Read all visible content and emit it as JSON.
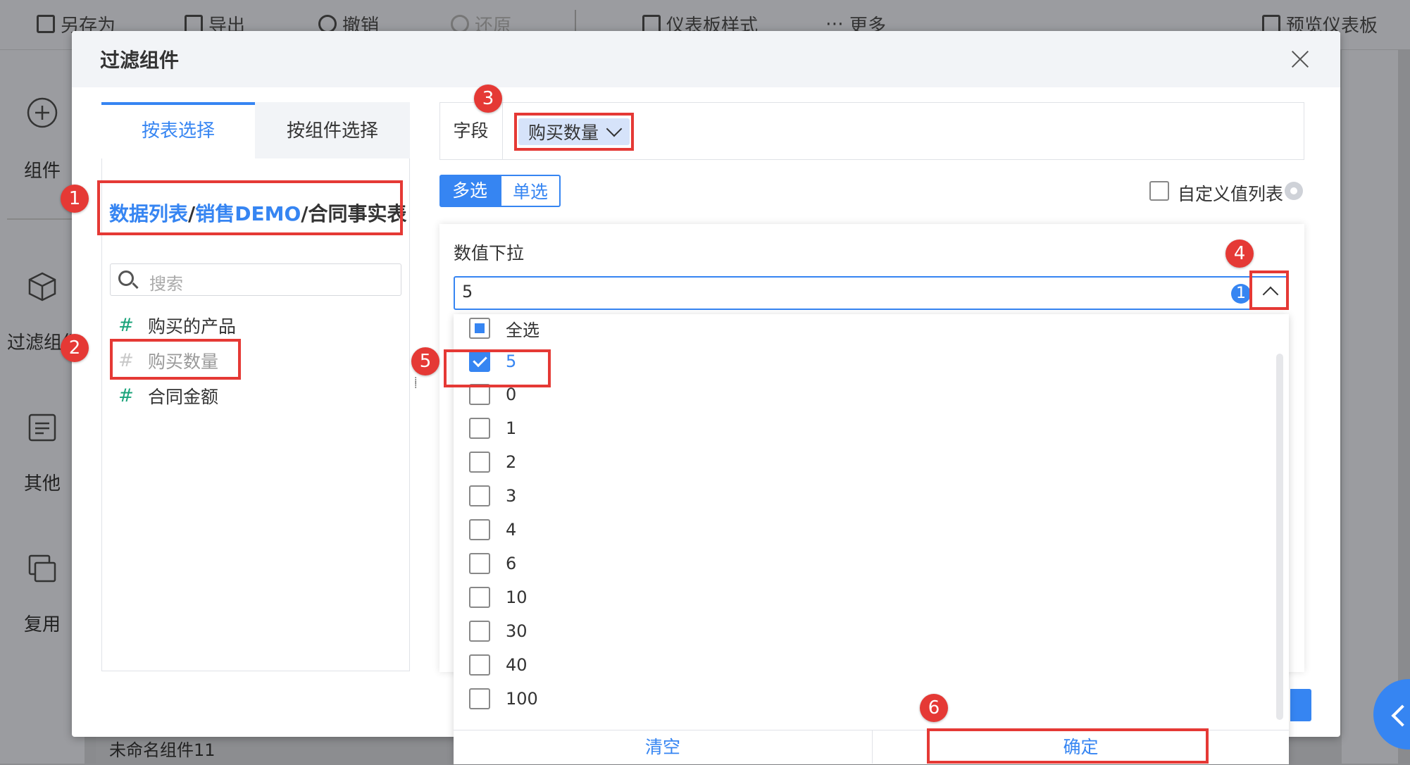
{
  "toolbar": {
    "items": [
      {
        "label": "另存为",
        "icon": "save-as-icon"
      },
      {
        "label": "导出",
        "icon": "export-icon"
      },
      {
        "label": "撤销",
        "icon": "undo-icon"
      },
      {
        "label": "还原",
        "icon": "redo-icon"
      },
      {
        "label": "仪表板样式",
        "icon": "dashboard-style-icon"
      },
      {
        "label": "更多",
        "icon": "more-icon"
      },
      {
        "label": "预览仪表板",
        "icon": "preview-icon"
      }
    ]
  },
  "left_panel": {
    "items": [
      {
        "label": "组件",
        "icon": "plus-circle-icon"
      },
      {
        "label": "过滤组件",
        "icon": "cube-icon"
      },
      {
        "label": "其他",
        "icon": "document-icon"
      },
      {
        "label": "复用",
        "icon": "copy-icon"
      }
    ]
  },
  "bottom_label": "未命名组件11",
  "dialog": {
    "title": "过滤组件",
    "tabs": [
      "按表选择",
      "按组件选择"
    ],
    "breadcrumb": {
      "part1": "数据列表",
      "sep1": "/",
      "part2": "销售DEMO",
      "sep2": "/",
      "current": "合同事实表"
    },
    "search_placeholder": "搜索",
    "fields": [
      {
        "hash": "#",
        "label": "购买的产品"
      },
      {
        "hash": "#",
        "label": "购买数量"
      },
      {
        "hash": "#",
        "label": "合同金额"
      }
    ],
    "field_label": "字段",
    "field_chip": "购买数量",
    "mode_multi": "多选",
    "mode_single": "单选",
    "custom_list_label": "自定义值列表",
    "card_title": "数值下拉",
    "dropdown_value": "5",
    "dropdown_badge": "1",
    "options": [
      "全选",
      "5",
      "0",
      "1",
      "2",
      "3",
      "4",
      "6",
      "10",
      "30",
      "40",
      "100"
    ],
    "clear_label": "清空",
    "confirm_label": "确定"
  },
  "annotations": [
    "1",
    "2",
    "3",
    "4",
    "5",
    "6"
  ],
  "colors": {
    "accent": "#3685f2",
    "annotation": "#e53935",
    "field_hash": "#1aa37a"
  }
}
